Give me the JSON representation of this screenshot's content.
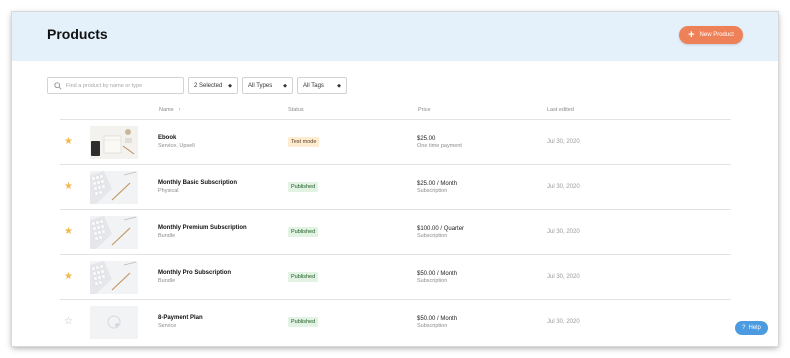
{
  "header": {
    "title": "Products",
    "new_button_label": "New Product",
    "new_button_icon": "plus-icon"
  },
  "filters": {
    "search_placeholder": "Find a product by name or type",
    "selected": "2 Selected",
    "types": "All Types",
    "tags": "All Tags"
  },
  "table": {
    "columns": [
      "Name",
      "Status",
      "Price",
      "Last edited"
    ],
    "sort_indicator": "↑",
    "rows": [
      {
        "starred": true,
        "name": "Ebook",
        "sub": "Service, Upsell",
        "status": "Test mode",
        "status_kind": "test",
        "price": "$25.00",
        "price_type": "One time payment",
        "edited": "Jul 30, 2020",
        "thumb": "desk-photo"
      },
      {
        "starred": true,
        "name": "Monthly Basic Subscription",
        "sub": "Physical",
        "status": "Published",
        "status_kind": "published",
        "price": "$25.00 / Month",
        "price_type": "Subscription",
        "edited": "Jul 30, 2020",
        "thumb": "keyboard-photo"
      },
      {
        "starred": true,
        "name": "Monthly Premium Subscription",
        "sub": "Bundle",
        "status": "Published",
        "status_kind": "published",
        "price": "$100.00 / Quarter",
        "price_type": "Subscription",
        "edited": "Jul 30, 2020",
        "thumb": "keyboard-photo"
      },
      {
        "starred": true,
        "name": "Monthly Pro Subscription",
        "sub": "Bundle",
        "status": "Published",
        "status_kind": "published",
        "price": "$50.00 / Month",
        "price_type": "Subscription",
        "edited": "Jul 30, 2020",
        "thumb": "keyboard-photo"
      },
      {
        "starred": false,
        "name": "8-Payment Plan",
        "sub": "Service",
        "status": "Published",
        "status_kind": "published",
        "price": "$50.00 / Month",
        "price_type": "Subscription",
        "edited": "Jul 30, 2020",
        "thumb": "placeholder"
      }
    ]
  },
  "help": {
    "label": "Help",
    "icon": "question-icon"
  },
  "colors": {
    "header_bg": "#e4f1fb",
    "accent": "#ef8158",
    "star": "#f2b84b",
    "published_bg": "#e2f3e3",
    "test_bg": "#fdecd2",
    "help_bg": "#4c9be0"
  }
}
